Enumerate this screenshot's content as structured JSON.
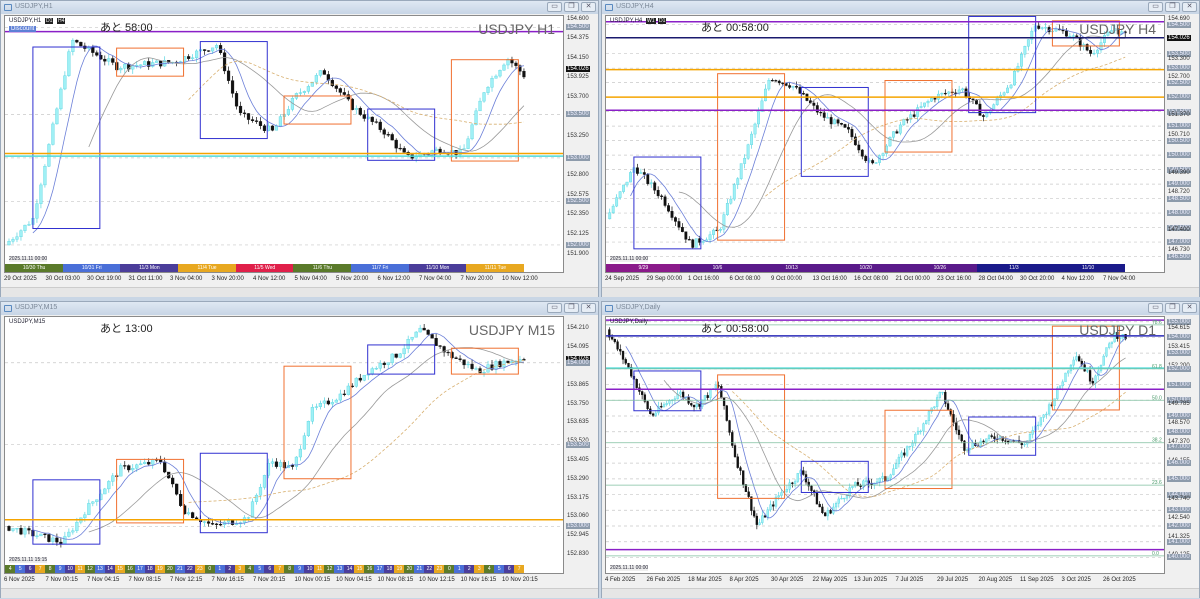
{
  "panels": [
    {
      "title": "USDJPY,H1",
      "symbol_small": "USDJPY,H1",
      "badge": "Discount",
      "tf_buttons": [
        "D1",
        "H4"
      ],
      "countdown": "あと 58:00",
      "big_label": "USDJPY H1",
      "range": [
        151.85,
        154.63
      ],
      "price_labels": [
        {
          "v": "154.600",
          "p": 154.6,
          "s": ""
        },
        {
          "v": "154.500",
          "p": 154.5,
          "s": "hl"
        },
        {
          "v": "154.375",
          "p": 154.375,
          "s": ""
        },
        {
          "v": "154.150",
          "p": 154.15,
          "s": ""
        },
        {
          "v": "154.026",
          "p": 154.026,
          "s": "bk"
        },
        {
          "v": "153.925",
          "p": 153.925,
          "s": ""
        },
        {
          "v": "153.700",
          "p": 153.7,
          "s": ""
        },
        {
          "v": "153.500",
          "p": 153.5,
          "s": "hl"
        },
        {
          "v": "153.250",
          "p": 153.25,
          "s": ""
        },
        {
          "v": "153.000",
          "p": 153.0,
          "s": "hl"
        },
        {
          "v": "152.800",
          "p": 152.8,
          "s": ""
        },
        {
          "v": "152.575",
          "p": 152.575,
          "s": ""
        },
        {
          "v": "152.500",
          "p": 152.5,
          "s": "hl"
        },
        {
          "v": "152.350",
          "p": 152.35,
          "s": ""
        },
        {
          "v": "152.125",
          "p": 152.125,
          "s": ""
        },
        {
          "v": "152.000",
          "p": 152.0,
          "s": "hl"
        },
        {
          "v": "151.900",
          "p": 151.9,
          "s": ""
        }
      ],
      "time_labels": [
        "29 Oct 2025",
        "30 Oct 03:00",
        "30 Oct 19:00",
        "31 Oct 11:00",
        "3 Nov 04:00",
        "3 Nov 20:00",
        "4 Nov 12:00",
        "5 Nov 04:00",
        "5 Nov 20:00",
        "6 Nov 12:00",
        "7 Nov 04:00",
        "7 Nov 20:00",
        "10 Nov 12:00"
      ],
      "session_labels": [
        "10/30 Thu",
        "10/31 Fri",
        "11/3 Mon",
        "11/4 Tue",
        "11/5 Wed",
        "11/6 Thu",
        "11/7 Fri",
        "11/10 Mon",
        "11/11 Tue"
      ],
      "footer_stamp": "2025.11.11 00:00",
      "price_path": [
        [
          0,
          152.0
        ],
        [
          0.05,
          152.3
        ],
        [
          0.12,
          154.35
        ],
        [
          0.2,
          154.05
        ],
        [
          0.3,
          154.1
        ],
        [
          0.38,
          154.3
        ],
        [
          0.42,
          153.5
        ],
        [
          0.48,
          153.3
        ],
        [
          0.52,
          153.7
        ],
        [
          0.57,
          154.0
        ],
        [
          0.62,
          153.6
        ],
        [
          0.68,
          153.3
        ],
        [
          0.72,
          153.0
        ],
        [
          0.78,
          153.1
        ],
        [
          0.82,
          153.05
        ],
        [
          0.86,
          153.8
        ],
        [
          0.9,
          154.15
        ],
        [
          0.93,
          153.95
        ]
      ],
      "lines": [
        {
          "p": 154.45,
          "c": "#8a1fc7"
        },
        {
          "p": 153.05,
          "c": "#f5a400"
        },
        {
          "p": 153.02,
          "c": "#4dd9d9"
        }
      ]
    },
    {
      "title": "USDJPY,H4",
      "symbol_small": "USDJPY,H4",
      "badge": "",
      "tf_buttons": [
        "W1",
        "D1"
      ],
      "countdown": "あと 00:58:00",
      "big_label": "USDJPY H4",
      "range": [
        146.45,
        154.8
      ],
      "price_labels": [
        {
          "v": "154.690",
          "p": 154.69,
          "s": ""
        },
        {
          "v": "154.500",
          "p": 154.5,
          "s": "hl"
        },
        {
          "v": "154.026",
          "p": 154.026,
          "s": "bk"
        },
        {
          "v": "153.500",
          "p": 153.5,
          "s": "hl"
        },
        {
          "v": "153.300",
          "p": 153.3,
          "s": ""
        },
        {
          "v": "153.000",
          "p": 153.0,
          "s": "hl"
        },
        {
          "v": "152.700",
          "p": 152.7,
          "s": ""
        },
        {
          "v": "152.500",
          "p": 152.5,
          "s": "hl"
        },
        {
          "v": "152.000",
          "p": 152.0,
          "s": "hl"
        },
        {
          "v": "151.500",
          "p": 151.5,
          "s": "hl"
        },
        {
          "v": "151.370",
          "p": 151.37,
          "s": ""
        },
        {
          "v": "151.000",
          "p": 151.0,
          "s": "hl"
        },
        {
          "v": "150.710",
          "p": 150.71,
          "s": ""
        },
        {
          "v": "150.500",
          "p": 150.5,
          "s": "hl"
        },
        {
          "v": "150.000",
          "p": 150.0,
          "s": "hl"
        },
        {
          "v": "149.500",
          "p": 149.5,
          "s": "hl"
        },
        {
          "v": "149.390",
          "p": 149.39,
          "s": ""
        },
        {
          "v": "149.000",
          "p": 149.0,
          "s": "hl"
        },
        {
          "v": "148.720",
          "p": 148.72,
          "s": ""
        },
        {
          "v": "148.500",
          "p": 148.5,
          "s": "hl"
        },
        {
          "v": "148.000",
          "p": 148.0,
          "s": "hl"
        },
        {
          "v": "147.500",
          "p": 147.5,
          "s": "hl"
        },
        {
          "v": "147.400",
          "p": 147.4,
          "s": ""
        },
        {
          "v": "147.000",
          "p": 147.0,
          "s": "hl"
        },
        {
          "v": "146.730",
          "p": 146.73,
          "s": ""
        },
        {
          "v": "146.500",
          "p": 146.5,
          "s": "hl"
        }
      ],
      "time_labels": [
        "24 Sep 2025",
        "29 Sep 00:00",
        "1 Oct 16:00",
        "6 Oct 08:00",
        "9 Oct 00:00",
        "13 Oct 16:00",
        "16 Oct 08:00",
        "21 Oct 00:00",
        "23 Oct 16:00",
        "28 Oct 04:00",
        "30 Oct 20:00",
        "4 Nov 12:00",
        "7 Nov 04:00"
      ],
      "session_labels": [
        "9/29",
        "10/6",
        "10/13",
        "10/20",
        "10/26",
        "11/3",
        "11/10"
      ],
      "footer_stamp": "2025.11.11 00:00",
      "price_path": [
        [
          0,
          147.8
        ],
        [
          0.05,
          149.6
        ],
        [
          0.1,
          148.5
        ],
        [
          0.15,
          146.9
        ],
        [
          0.2,
          147.4
        ],
        [
          0.25,
          150.2
        ],
        [
          0.29,
          152.7
        ],
        [
          0.33,
          152.4
        ],
        [
          0.38,
          151.4
        ],
        [
          0.43,
          150.8
        ],
        [
          0.47,
          149.6
        ],
        [
          0.52,
          151.0
        ],
        [
          0.58,
          152.0
        ],
        [
          0.63,
          152.3
        ],
        [
          0.67,
          151.3
        ],
        [
          0.72,
          152.6
        ],
        [
          0.76,
          154.5
        ],
        [
          0.82,
          154.2
        ],
        [
          0.86,
          153.5
        ],
        [
          0.9,
          154.4
        ],
        [
          0.92,
          154.1
        ]
      ],
      "lines": [
        {
          "p": 154.6,
          "c": "#8a1fc7"
        },
        {
          "p": 151.55,
          "c": "#8a1fc7"
        },
        {
          "p": 152.95,
          "c": "#f5a400"
        },
        {
          "p": 152.0,
          "c": "#f5a400"
        },
        {
          "p": 154.05,
          "c": "#1a1a6e"
        }
      ]
    },
    {
      "title": "USDJPY,M15",
      "symbol_small": "USDJPY,M15",
      "badge": "",
      "tf_buttons": [],
      "countdown": "あと 13:00",
      "big_label": "USDJPY M15",
      "range": [
        152.8,
        154.28
      ],
      "price_labels": [
        {
          "v": "154.210",
          "p": 154.21,
          "s": ""
        },
        {
          "v": "154.095",
          "p": 154.095,
          "s": ""
        },
        {
          "v": "154.026",
          "p": 154.026,
          "s": "bk"
        },
        {
          "v": "154.000",
          "p": 154.0,
          "s": "hl"
        },
        {
          "v": "153.865",
          "p": 153.865,
          "s": ""
        },
        {
          "v": "153.750",
          "p": 153.75,
          "s": ""
        },
        {
          "v": "153.635",
          "p": 153.635,
          "s": ""
        },
        {
          "v": "153.520",
          "p": 153.52,
          "s": ""
        },
        {
          "v": "153.500",
          "p": 153.5,
          "s": "hl"
        },
        {
          "v": "153.405",
          "p": 153.405,
          "s": ""
        },
        {
          "v": "153.290",
          "p": 153.29,
          "s": ""
        },
        {
          "v": "153.175",
          "p": 153.175,
          "s": ""
        },
        {
          "v": "153.060",
          "p": 153.06,
          "s": ""
        },
        {
          "v": "153.000",
          "p": 153.0,
          "s": "hl"
        },
        {
          "v": "152.945",
          "p": 152.945,
          "s": ""
        },
        {
          "v": "152.830",
          "p": 152.83,
          "s": ""
        }
      ],
      "time_labels": [
        "6 Nov 2025",
        "7 Nov 00:15",
        "7 Nov 04:15",
        "7 Nov 08:15",
        "7 Nov 12:15",
        "7 Nov 16:15",
        "7 Nov 20:15",
        "10 Nov 00:15",
        "10 Nov 04:15",
        "10 Nov 08:15",
        "10 Nov 12:15",
        "10 Nov 16:15",
        "10 Nov 20:15"
      ],
      "session_labels": [
        "4",
        "5",
        "6",
        "7",
        "8",
        "9",
        "10",
        "11",
        "12",
        "13",
        "14",
        "15",
        "16",
        "17",
        "18",
        "19",
        "20",
        "21",
        "22",
        "23",
        "0",
        "1",
        "2",
        "3",
        "4",
        "5",
        "6",
        "7",
        "8",
        "9",
        "10",
        "11",
        "12",
        "13",
        "14",
        "15",
        "16",
        "17",
        "18",
        "19",
        "20",
        "21",
        "22",
        "23",
        "0",
        "1",
        "2",
        "3",
        "4",
        "5",
        "6",
        "7"
      ],
      "footer_stamp": "2025.11.11 15:15",
      "price_path": [
        [
          0,
          153.0
        ],
        [
          0.05,
          152.95
        ],
        [
          0.1,
          152.9
        ],
        [
          0.14,
          153.1
        ],
        [
          0.2,
          153.35
        ],
        [
          0.27,
          153.4
        ],
        [
          0.31,
          153.1
        ],
        [
          0.36,
          153.0
        ],
        [
          0.42,
          153.05
        ],
        [
          0.46,
          153.4
        ],
        [
          0.5,
          153.35
        ],
        [
          0.53,
          153.7
        ],
        [
          0.58,
          153.8
        ],
        [
          0.63,
          153.95
        ],
        [
          0.68,
          154.05
        ],
        [
          0.72,
          154.2
        ],
        [
          0.77,
          154.05
        ],
        [
          0.82,
          153.95
        ],
        [
          0.86,
          154.0
        ],
        [
          0.9,
          154.03
        ]
      ],
      "lines": [
        {
          "p": 153.04,
          "c": "#f5a400"
        }
      ]
    },
    {
      "title": "USDJPY,Daily",
      "symbol_small": "USDJPY,Daily",
      "badge": "",
      "tf_buttons": [],
      "countdown": "あと 00:58:00",
      "big_label": "USDJPY D1",
      "range": [
        139.9,
        155.3
      ],
      "price_labels": [
        {
          "v": "155.000",
          "p": 155.0,
          "s": "hl"
        },
        {
          "v": "154.615",
          "p": 154.615,
          "s": ""
        },
        {
          "v": "154.000",
          "p": 154.0,
          "s": "hl"
        },
        {
          "v": "153.415",
          "p": 153.415,
          "s": ""
        },
        {
          "v": "153.000",
          "p": 153.0,
          "s": "hl"
        },
        {
          "v": "152.200",
          "p": 152.2,
          "s": ""
        },
        {
          "v": "152.000",
          "p": 152.0,
          "s": "hl"
        },
        {
          "v": "151.000",
          "p": 151.0,
          "s": "hl"
        },
        {
          "v": "150.000",
          "p": 150.0,
          "s": "hl"
        },
        {
          "v": "149.785",
          "p": 149.785,
          "s": ""
        },
        {
          "v": "149.000",
          "p": 149.0,
          "s": "hl"
        },
        {
          "v": "148.570",
          "p": 148.57,
          "s": ""
        },
        {
          "v": "148.000",
          "p": 148.0,
          "s": "hl"
        },
        {
          "v": "147.370",
          "p": 147.37,
          "s": ""
        },
        {
          "v": "147.000",
          "p": 147.0,
          "s": "hl"
        },
        {
          "v": "146.155",
          "p": 146.155,
          "s": ""
        },
        {
          "v": "146.000",
          "p": 146.0,
          "s": "hl"
        },
        {
          "v": "145.000",
          "p": 145.0,
          "s": "hl"
        },
        {
          "v": "144.000",
          "p": 144.0,
          "s": "hl"
        },
        {
          "v": "143.740",
          "p": 143.74,
          "s": ""
        },
        {
          "v": "143.000",
          "p": 143.0,
          "s": "hl"
        },
        {
          "v": "142.540",
          "p": 142.54,
          "s": ""
        },
        {
          "v": "142.000",
          "p": 142.0,
          "s": "hl"
        },
        {
          "v": "141.325",
          "p": 141.325,
          "s": ""
        },
        {
          "v": "141.000",
          "p": 141.0,
          "s": "hl"
        },
        {
          "v": "140.135",
          "p": 140.135,
          "s": ""
        },
        {
          "v": "140.000",
          "p": 140.0,
          "s": "hl"
        }
      ],
      "fib_labels": [
        {
          "v": "78.6",
          "p": 154.8
        },
        {
          "v": "61.8",
          "p": 152.0
        },
        {
          "v": "50.0",
          "p": 150.0
        },
        {
          "v": "38.2",
          "p": 147.3
        },
        {
          "v": "23.6",
          "p": 144.6
        },
        {
          "v": "0.0",
          "p": 140.1
        }
      ],
      "time_labels": [
        "4 Feb 2025",
        "26 Feb 2025",
        "18 Mar 2025",
        "8 Apr 2025",
        "30 Apr 2025",
        "22 May 2025",
        "13 Jun 2025",
        "7 Jul 2025",
        "29 Jul 2025",
        "20 Aug 2025",
        "11 Sep 2025",
        "3 Oct 2025",
        "26 Oct 2025"
      ],
      "session_labels": [],
      "footer_stamp": "2025.11.11 00:00",
      "price_path": [
        [
          0,
          154.5
        ],
        [
          0.04,
          152.0
        ],
        [
          0.08,
          149.0
        ],
        [
          0.13,
          150.5
        ],
        [
          0.16,
          149.6
        ],
        [
          0.2,
          151.0
        ],
        [
          0.23,
          146.5
        ],
        [
          0.27,
          142.0
        ],
        [
          0.31,
          144.0
        ],
        [
          0.35,
          145.5
        ],
        [
          0.39,
          142.6
        ],
        [
          0.44,
          144.5
        ],
        [
          0.5,
          145.0
        ],
        [
          0.55,
          147.5
        ],
        [
          0.6,
          150.5
        ],
        [
          0.64,
          147.0
        ],
        [
          0.7,
          147.7
        ],
        [
          0.75,
          147.2
        ],
        [
          0.8,
          150.0
        ],
        [
          0.84,
          153.0
        ],
        [
          0.87,
          151.2
        ],
        [
          0.91,
          154.2
        ],
        [
          0.93,
          154.0
        ]
      ],
      "lines": [
        {
          "p": 155.1,
          "c": "#8a1fc7"
        },
        {
          "p": 150.7,
          "c": "#8a1fc7"
        },
        {
          "p": 140.5,
          "c": "#8a1fc7"
        },
        {
          "p": 152.05,
          "c": "#4dd9d9"
        },
        {
          "p": 154.1,
          "c": "#2a2ab8"
        }
      ]
    }
  ],
  "window_buttons": {
    "minimize": "▭",
    "restore": "❐",
    "close": "✕"
  }
}
